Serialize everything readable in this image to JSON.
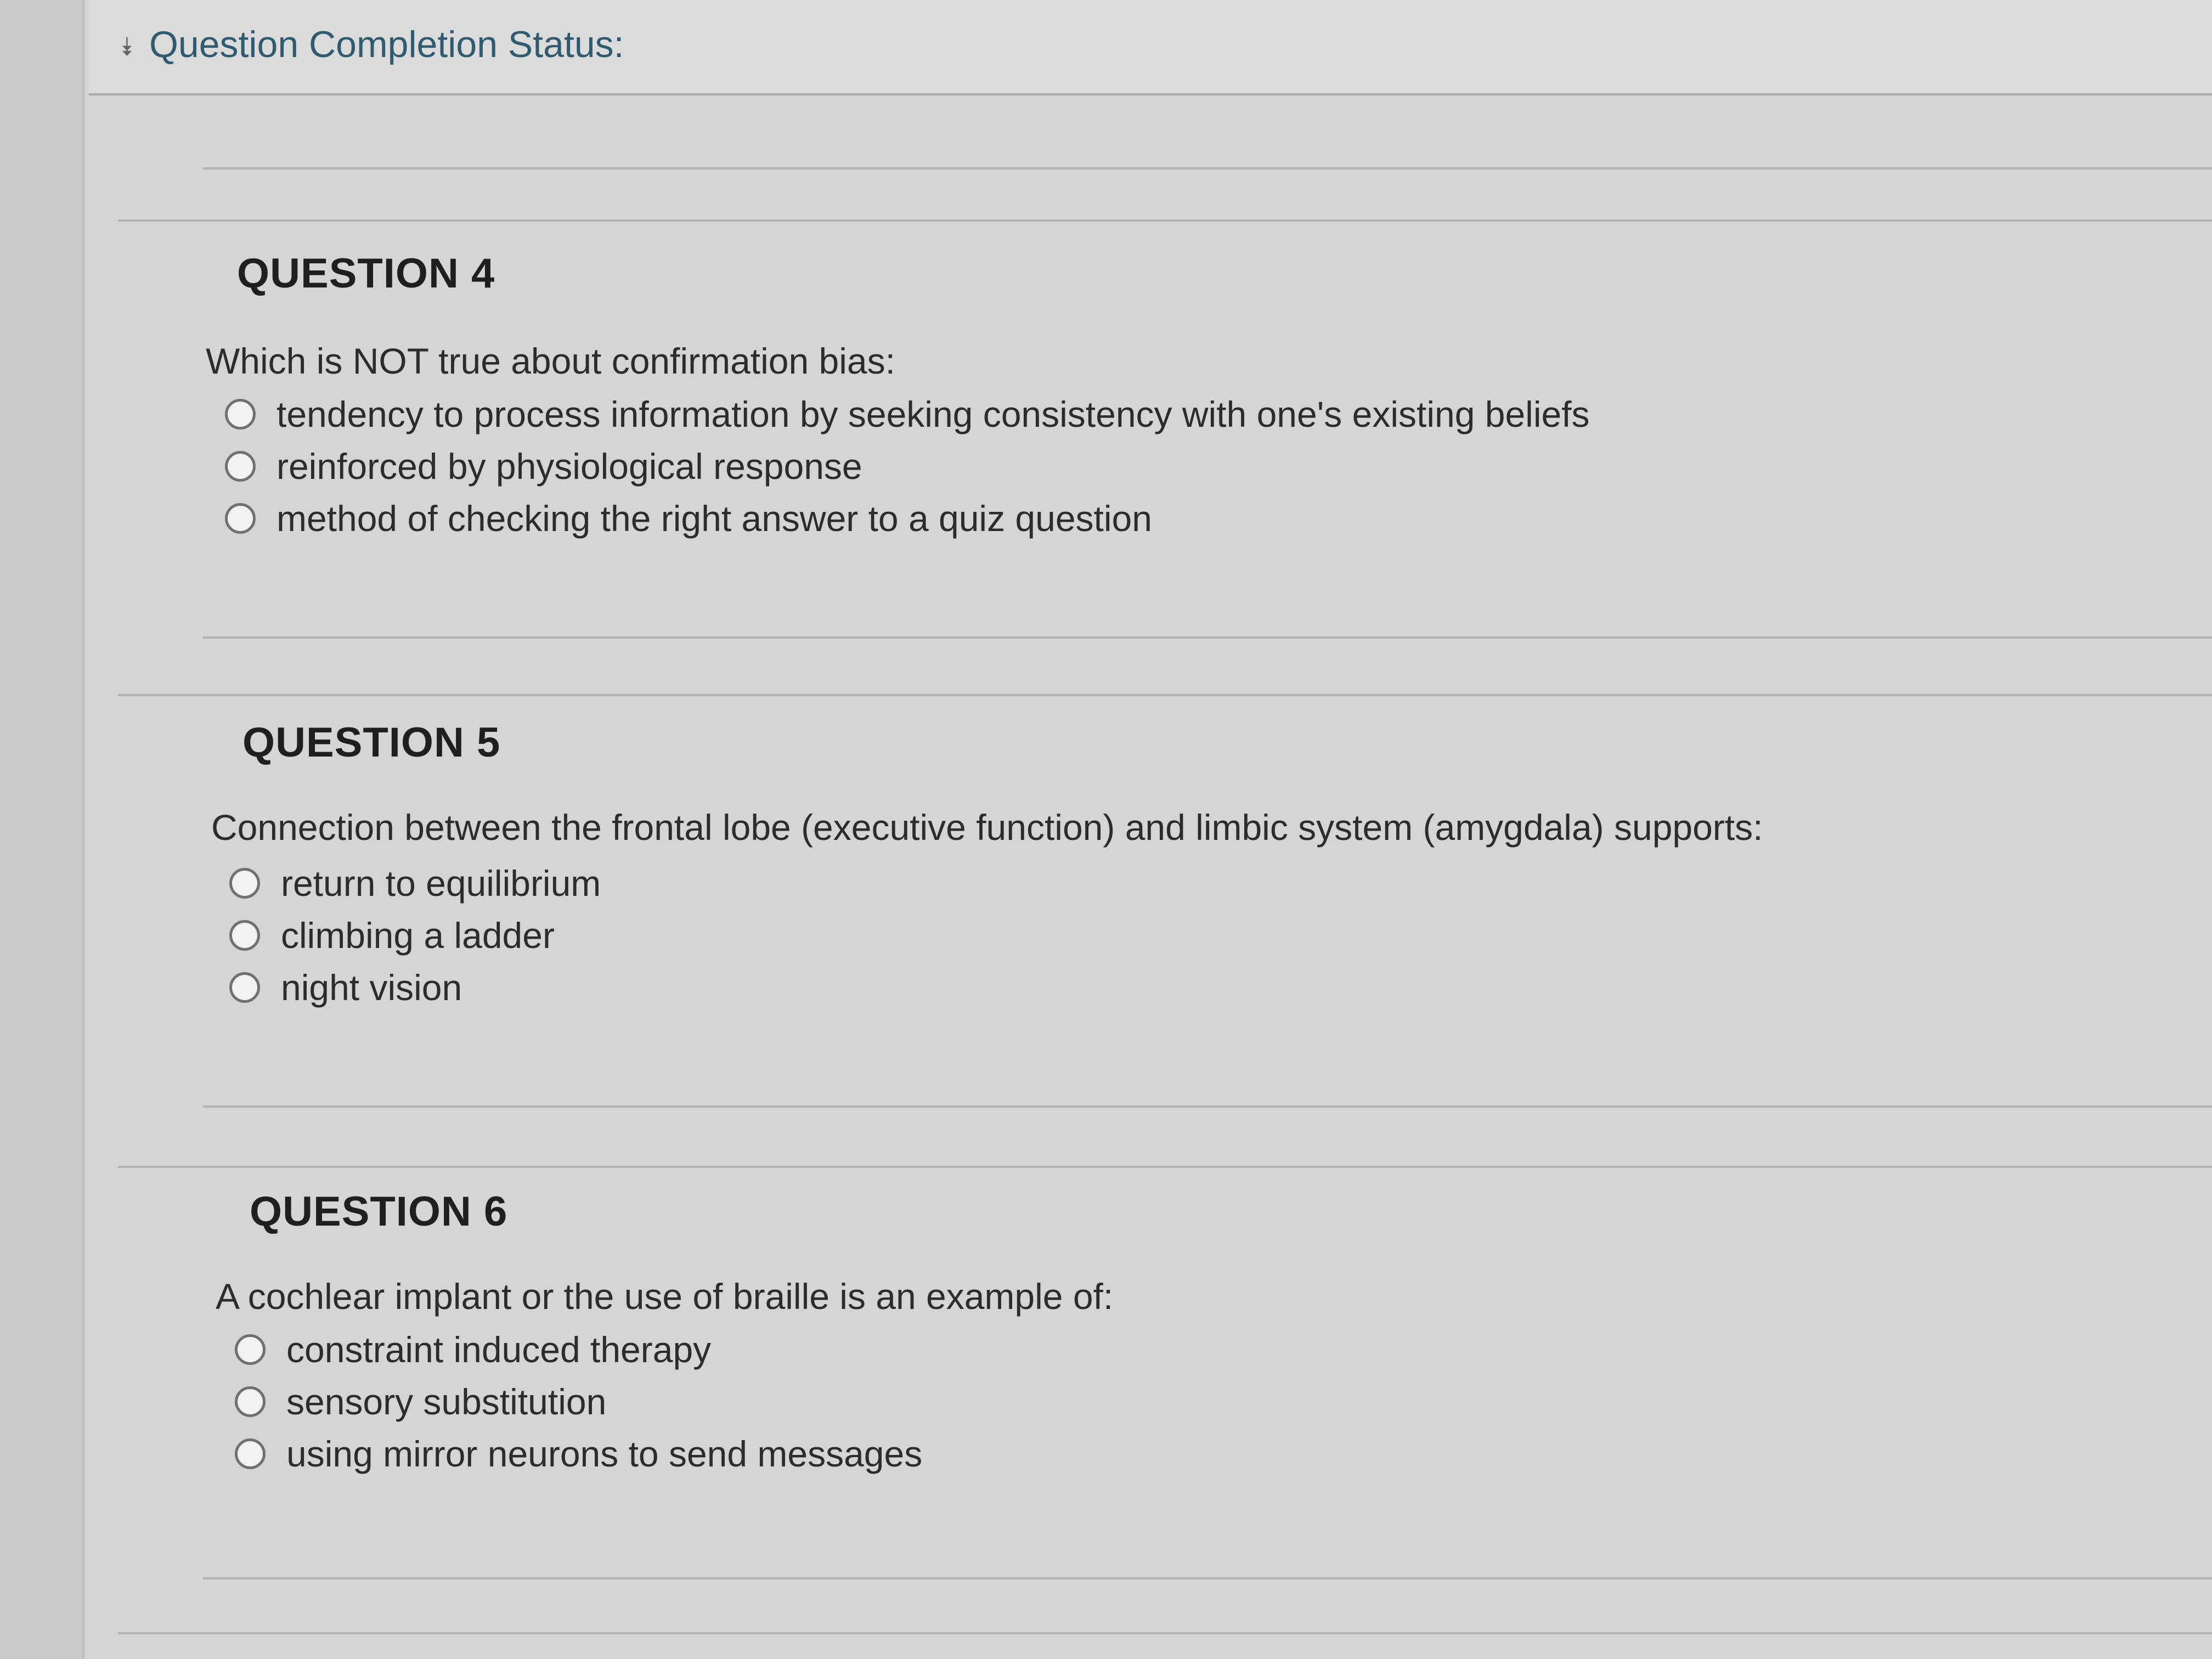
{
  "status": {
    "label": "Question Completion Status:",
    "toggle_icon": "double-chevron-down-icon"
  },
  "questions": [
    {
      "title": "QUESTION 4",
      "prompt": "Which is NOT true about confirmation bias:",
      "options": [
        {
          "label": "tendency to process information by seeking consistency with one's existing beliefs",
          "selected": false
        },
        {
          "label": "reinforced by physiological response",
          "selected": false
        },
        {
          "label": "method of checking the right answer to a quiz question",
          "selected": false
        }
      ]
    },
    {
      "title": "QUESTION 5",
      "prompt": "Connection between the frontal lobe (executive function) and limbic system (amygdala) supports:",
      "options": [
        {
          "label": "return to equilibrium",
          "selected": false
        },
        {
          "label": "climbing a ladder",
          "selected": false
        },
        {
          "label": "night vision",
          "selected": false
        }
      ]
    },
    {
      "title": "QUESTION 6",
      "prompt": "A cochlear implant or the use of braille is an example of:",
      "options": [
        {
          "label": "constraint induced therapy",
          "selected": false
        },
        {
          "label": "sensory substitution",
          "selected": false
        },
        {
          "label": "using mirror neurons to send messages",
          "selected": false
        }
      ]
    }
  ]
}
